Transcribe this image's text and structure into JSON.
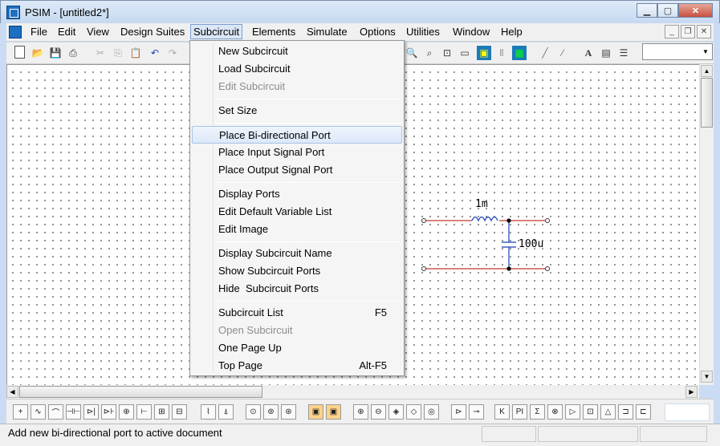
{
  "window": {
    "title": "PSIM - [untitled2*]"
  },
  "menubar": {
    "items": [
      "File",
      "Edit",
      "View",
      "Design Suites",
      "Subcircuit",
      "Elements",
      "Simulate",
      "Options",
      "Utilities",
      "Window",
      "Help"
    ],
    "active": "Subcircuit"
  },
  "subcircuit_menu": {
    "items": [
      {
        "label": "New Subcircuit",
        "shortcut": "",
        "disabled": false
      },
      {
        "label": "Load Subcircuit",
        "shortcut": "",
        "disabled": false
      },
      {
        "label": "Edit Subcircuit",
        "shortcut": "",
        "disabled": true
      },
      {
        "label": "Set Size",
        "shortcut": "",
        "disabled": false
      },
      {
        "label": "Place Bi-directional Port",
        "shortcut": "",
        "disabled": false,
        "highlighted": true
      },
      {
        "label": "Place Input Signal Port",
        "shortcut": "",
        "disabled": false
      },
      {
        "label": "Place Output Signal Port",
        "shortcut": "",
        "disabled": false
      },
      {
        "label": "Display Ports",
        "shortcut": "",
        "disabled": false
      },
      {
        "label": "Edit Default Variable List",
        "shortcut": "",
        "disabled": false
      },
      {
        "label": "Edit Image",
        "shortcut": "",
        "disabled": false
      },
      {
        "label": "Display Subcircuit Name",
        "shortcut": "",
        "disabled": false
      },
      {
        "label": "Show Subcircuit Ports",
        "shortcut": "",
        "disabled": false
      },
      {
        "label": "Hide  Subcircuit Ports",
        "shortcut": "",
        "disabled": false
      },
      {
        "label": "Subcircuit List",
        "shortcut": "F5",
        "disabled": false
      },
      {
        "label": "Open Subcircuit",
        "shortcut": "",
        "disabled": true
      },
      {
        "label": "One Page Up",
        "shortcut": "",
        "disabled": false
      },
      {
        "label": "Top Page",
        "shortcut": "Alt-F5",
        "disabled": false
      }
    ]
  },
  "circuit": {
    "inductor_label": "1m",
    "capacitor_label": "100u",
    "wire_color": "#c0392b",
    "component_color": "#1a3fbf"
  },
  "statusbar": {
    "text": "Add new bi-directional port to active document"
  },
  "colors": {
    "highlight": "#dce9f9",
    "titlebar": "#c6d9f1"
  }
}
